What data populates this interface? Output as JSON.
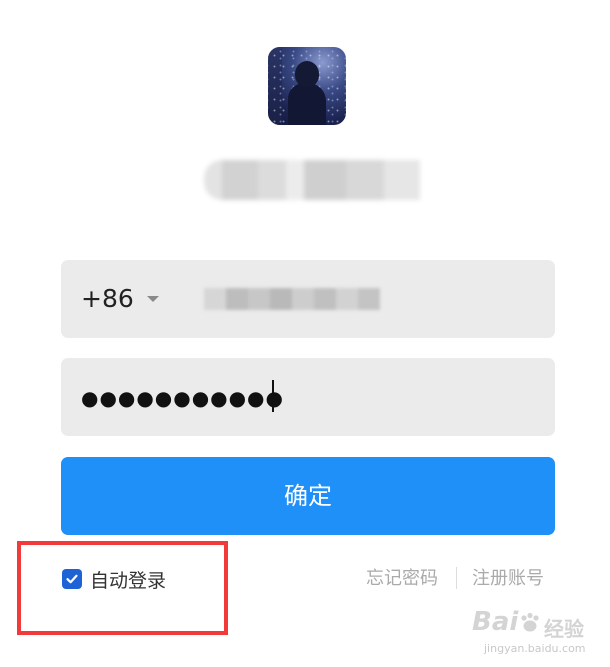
{
  "login": {
    "phone": {
      "country_code": "+86",
      "number": ""
    },
    "password": {
      "masked_value": "●●●●●●●●●●●"
    },
    "confirm_label": "确定",
    "auto_login": {
      "label": "自动登录",
      "checked": true
    },
    "forgot_password_label": "忘记密码",
    "register_label": "注册账号"
  },
  "watermark": {
    "logo_text": "Bai",
    "brand_cn": "经验",
    "url": "jingyan.baidu.com"
  },
  "colors": {
    "primary": "#1e90f7",
    "checkbox": "#1e63d6",
    "field_bg": "#ebebeb",
    "link_gray": "#aaaaaa",
    "highlight_red": "#f23a3a"
  },
  "icons": {
    "country_dropdown": "caret-down-icon",
    "checkbox_mark": "check-icon"
  }
}
